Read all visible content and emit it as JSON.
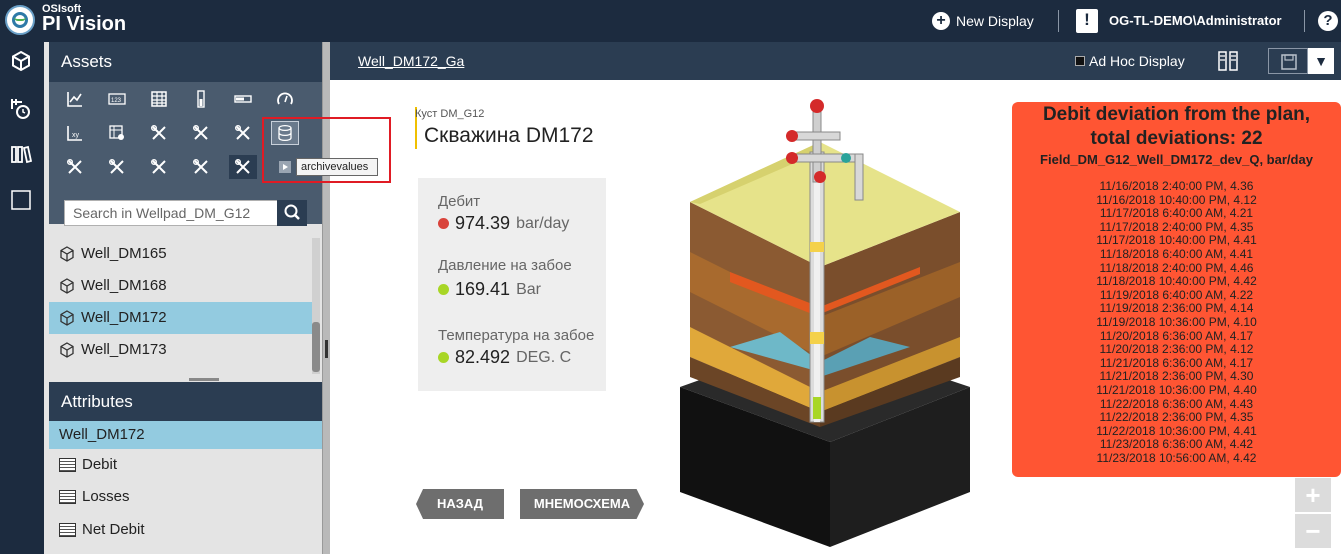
{
  "app": {
    "brand_small": "OSIsoft",
    "brand_big": "PI Vision",
    "new_display_label": "New Display",
    "user": "OG-TL-DEMO\\Administrator",
    "notification_icon": "exclamation-icon",
    "help_icon": "question-icon"
  },
  "rail": {
    "icons": [
      "cube-icon",
      "events-icon",
      "library-icon",
      "display-icon"
    ]
  },
  "assets": {
    "title": "Assets",
    "symbol_icons": [
      "trend-icon",
      "value-icon",
      "table-icon",
      "vertical-gauge-icon",
      "horizontal-gauge-icon",
      "radial-gauge-icon",
      "xy-plot-icon",
      "asset-comparison-icon",
      "tool-icon",
      "tool-icon",
      "tool-icon",
      "database-icon",
      "tool-icon",
      "tool-icon",
      "tool-icon",
      "tool-icon",
      "tool-icon",
      "play-icon"
    ],
    "tooltip": "archivevalues",
    "search_placeholder": "Search in Wellpad_DM_G12",
    "items": [
      {
        "label": "Well_DM165",
        "selected": false
      },
      {
        "label": "Well_DM168",
        "selected": false
      },
      {
        "label": "Well_DM172",
        "selected": true
      },
      {
        "label": "Well_DM173",
        "selected": false
      }
    ]
  },
  "attributes": {
    "title": "Attributes",
    "selected": "Well_DM172",
    "items": [
      "Debit",
      "Losses",
      "Net Debit"
    ]
  },
  "display": {
    "title": "Well_DM172_Ga",
    "adhoc_label": "Ad Hoc Display",
    "kust_label": "Куст DM_G12",
    "well_title": "Скважина DM172",
    "kpis": [
      {
        "label": "Дебит",
        "value": "974.39",
        "unit": "bar/day",
        "dot_color": "#d9433b"
      },
      {
        "label": "Давление на забое",
        "value": "169.41",
        "unit": "Bar",
        "dot_color": "#a8d626"
      },
      {
        "label": "Температура на забое",
        "value": "82.492",
        "unit": "DEG. C",
        "dot_color": "#a8d626"
      }
    ],
    "buttons": {
      "back": "НАЗАД",
      "mnemo": "МНЕМОСХЕМА"
    },
    "deviation": {
      "title_line1": "Debit deviation from the plan,",
      "title_line2": "total deviations: 22",
      "subtitle": "Field_DM_G12_Well_DM172_dev_Q, bar/day",
      "entries": [
        "11/16/2018 2:40:00 PM, 4.36",
        "11/16/2018 10:40:00 PM, 4.12",
        "11/17/2018 6:40:00 AM, 4.21",
        "11/17/2018 2:40:00 PM, 4.35",
        "11/17/2018 10:40:00 PM, 4.41",
        "11/18/2018 6:40:00 AM, 4.41",
        "11/18/2018 2:40:00 PM, 4.46",
        "11/18/2018 10:40:00 PM, 4.42",
        "11/19/2018 6:40:00 AM, 4.22",
        "11/19/2018 2:36:00 PM, 4.14",
        "11/19/2018 10:36:00 PM, 4.10",
        "11/20/2018 6:36:00 AM, 4.17",
        "11/20/2018 2:36:00 PM, 4.12",
        "11/21/2018 6:36:00 AM, 4.17",
        "11/21/2018 2:36:00 PM, 4.30",
        "11/21/2018 10:36:00 PM, 4.40",
        "11/22/2018 6:36:00 AM, 4.43",
        "11/22/2018 2:36:00 PM, 4.35",
        "11/22/2018 10:36:00 PM, 4.41",
        "11/23/2018 6:36:00 AM, 4.42",
        "11/23/2018 10:56:00 AM, 4.42"
      ]
    },
    "zoom": {
      "in": "+",
      "out": "−"
    },
    "colors": {
      "deviation_panel": "#ff5533",
      "header": "#1c2b3f",
      "selection": "#93cbe0"
    }
  }
}
